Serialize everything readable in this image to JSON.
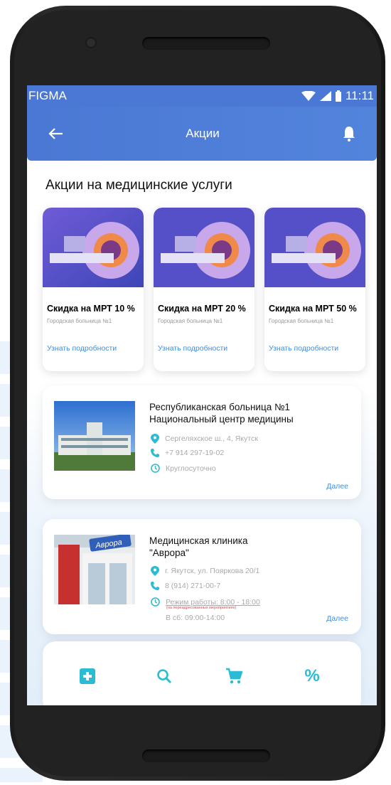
{
  "status_bar": {
    "carrier": "FIGMA",
    "time": "11:11"
  },
  "app_bar": {
    "title": "Акции"
  },
  "section": {
    "title": "Акции на медицинские услуги"
  },
  "promos": [
    {
      "title": "Скидка на МРТ 10 %",
      "subtitle": "Городская больница №1",
      "link": "Узнать подробности"
    },
    {
      "title": "Скидка на МРТ 20 %",
      "subtitle": "Городская больница №1",
      "link": "Узнать подробности"
    },
    {
      "title": "Скидка на МРТ 50 %",
      "subtitle": "Городская больница №1",
      "link": "Узнать подробности"
    }
  ],
  "clinics": [
    {
      "name_line1": "Республиканская больница №1",
      "name_line2": "Национальный центр медицины",
      "address": "Сергеляхское ш., 4, Якутск",
      "phone": "+7 914 297-19-02",
      "hours": "Круглосуточно",
      "more": "Далее"
    },
    {
      "name_line1": "Медицинская клиника",
      "name_line2": "\"Аврора\"",
      "sign_text": "Аврора",
      "address": "г. Якутск, ул. Пояркова 20/1",
      "phone": "8 (914) 271-00-7",
      "hours": "Режим работы: 8:00 - 18:00",
      "hours_note": "(на переадресованных мероприятиях)",
      "hours_extra": "В сб: 09:00-14:00",
      "more": "Далее"
    }
  ],
  "colors": {
    "primary": "#4a78d4",
    "accent": "#2bbcd4",
    "link": "#3b8fe4"
  },
  "tabs": [
    {
      "icon": "medical-cross-icon"
    },
    {
      "icon": "search-icon"
    },
    {
      "icon": "cart-icon"
    },
    {
      "icon": "percent-icon",
      "glyph": "%"
    }
  ]
}
